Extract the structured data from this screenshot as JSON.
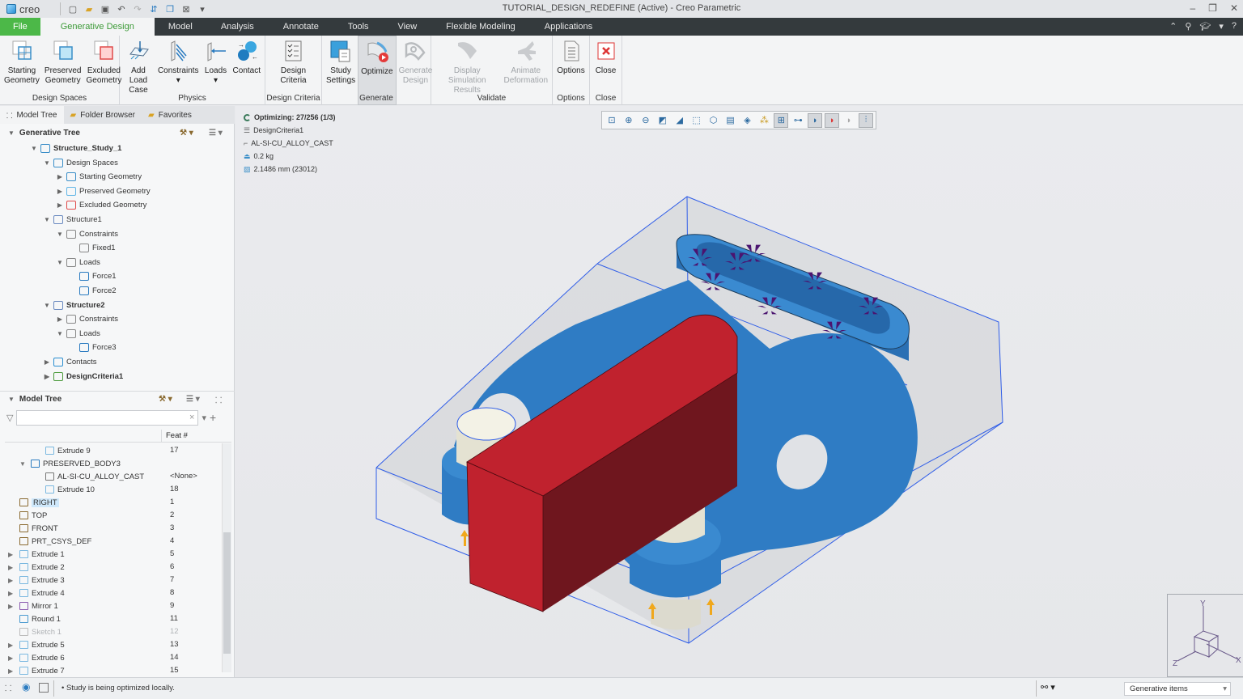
{
  "window": {
    "app_name": "creo",
    "title": "TUTORIAL_DESIGN_REDEFINE (Active) - Creo Parametric"
  },
  "quick_access": [
    "new-icon",
    "open-icon",
    "save-icon",
    "undo-icon",
    "redo-icon",
    "regenerate-icon",
    "windows-icon",
    "close-window-icon",
    "customize-icon"
  ],
  "tabs": [
    {
      "label": "File"
    },
    {
      "label": "Generative Design",
      "active": true
    },
    {
      "label": "Model"
    },
    {
      "label": "Analysis"
    },
    {
      "label": "Annotate"
    },
    {
      "label": "Tools"
    },
    {
      "label": "View"
    },
    {
      "label": "Flexible Modeling"
    },
    {
      "label": "Applications"
    }
  ],
  "ribbon": {
    "groups": [
      {
        "label": "Design Spaces",
        "buttons": [
          {
            "label1": "Starting",
            "label2": "Geometry"
          },
          {
            "label1": "Preserved",
            "label2": "Geometry"
          },
          {
            "label1": "Excluded",
            "label2": "Geometry"
          }
        ]
      },
      {
        "label": "Physics",
        "buttons": [
          {
            "label1": "Add Load",
            "label2": "Case"
          },
          {
            "label1": "Constraints",
            "label2": "▾"
          },
          {
            "label1": "Loads",
            "label2": "▾"
          },
          {
            "label1": "Contact",
            "label2": ""
          }
        ]
      },
      {
        "label": "Design Criteria",
        "buttons": [
          {
            "label1": "Design",
            "label2": "Criteria"
          }
        ]
      },
      {
        "label": "Generate",
        "buttons": [
          {
            "label1": "Study",
            "label2": "Settings"
          },
          {
            "label1": "Optimize",
            "label2": ""
          },
          {
            "label1": "Generate",
            "label2": "Design"
          }
        ]
      },
      {
        "label": "Validate",
        "buttons": [
          {
            "label1": "Display",
            "label2": "Simulation Results"
          },
          {
            "label1": "Animate",
            "label2": "Deformation"
          }
        ]
      },
      {
        "label": "Options",
        "buttons": [
          {
            "label1": "Options",
            "label2": ""
          }
        ]
      },
      {
        "label": "Close",
        "buttons": [
          {
            "label1": "Close",
            "label2": ""
          }
        ]
      }
    ]
  },
  "left_tabs": [
    {
      "label": "Model Tree"
    },
    {
      "label": "Folder Browser"
    },
    {
      "label": "Favorites"
    }
  ],
  "generative_tree": {
    "header": "Generative Tree",
    "nodes": [
      {
        "label": "Structure_Study_1",
        "bold": true
      },
      {
        "label": "Design Spaces"
      },
      {
        "label": "Starting Geometry"
      },
      {
        "label": "Preserved Geometry"
      },
      {
        "label": "Excluded Geometry"
      },
      {
        "label": "Structure1"
      },
      {
        "label": "Constraints"
      },
      {
        "label": "Fixed1"
      },
      {
        "label": "Loads"
      },
      {
        "label": "Force1"
      },
      {
        "label": "Force2"
      },
      {
        "label": "Structure2",
        "bold": true
      },
      {
        "label": "Constraints"
      },
      {
        "label": "Loads"
      },
      {
        "label": "Force3"
      },
      {
        "label": "Contacts"
      },
      {
        "label": "DesignCriteria1",
        "bold": true
      }
    ]
  },
  "model_tree": {
    "header": "Model Tree",
    "filter_value": "",
    "column_header": "Feat #",
    "rows": [
      {
        "name": "Extrude 9",
        "feat": "17"
      },
      {
        "name": "PRESERVED_BODY3",
        "feat": ""
      },
      {
        "name": "AL-SI-CU_ALLOY_CAST",
        "feat": "<None>"
      },
      {
        "name": "Extrude 10",
        "feat": "18"
      },
      {
        "name": "RIGHT",
        "feat": "1",
        "selected": true
      },
      {
        "name": "TOP",
        "feat": "2"
      },
      {
        "name": "FRONT",
        "feat": "3"
      },
      {
        "name": "PRT_CSYS_DEF",
        "feat": "4"
      },
      {
        "name": "Extrude 1",
        "feat": "5"
      },
      {
        "name": "Extrude 2",
        "feat": "6"
      },
      {
        "name": "Extrude 3",
        "feat": "7"
      },
      {
        "name": "Extrude 4",
        "feat": "8"
      },
      {
        "name": "Mirror 1",
        "feat": "9"
      },
      {
        "name": "Round 1",
        "feat": "11"
      },
      {
        "name": "Sketch 1",
        "feat": "12",
        "suppressed": true
      },
      {
        "name": "Extrude 5",
        "feat": "13"
      },
      {
        "name": "Extrude 6",
        "feat": "14"
      },
      {
        "name": "Extrude 7",
        "feat": "15"
      }
    ]
  },
  "viewport": {
    "status": "Optimizing: 27/256 (1/3)",
    "criteria": "DesignCriteria1",
    "material": "AL-SI-CU_ALLOY_CAST",
    "mass": "0.2 kg",
    "mesh": "2.1486 mm (23012)",
    "toolbar": [
      "refit-icon",
      "zoom-in-icon",
      "zoom-out-icon",
      "repaint-icon",
      "display-style-icon",
      "saved-orientations-icon",
      "view-manager-icon",
      "annotation-display-icon",
      "spin-center-icon",
      "datum-display-icon",
      "show-generative-icon",
      "connection-icon",
      "show-design-icon",
      "show-optimization-icon",
      "show-shape-icon",
      "show-thermal-icon"
    ],
    "triad_labels": {
      "x": "X",
      "y": "Y",
      "z": "Z"
    }
  },
  "colors": {
    "accent_green": "#4cb848",
    "tab_dark": "#343a3d",
    "body_blue": "#2f7cc4",
    "excluded_red": "#c0222e",
    "preserved_ivory": "#efeee2",
    "load_purple": "#4b1470",
    "constraint_orange": "#f0a81c"
  },
  "statusbar": {
    "message": "Study is being optimized locally.",
    "filter_value": "Generative items"
  }
}
